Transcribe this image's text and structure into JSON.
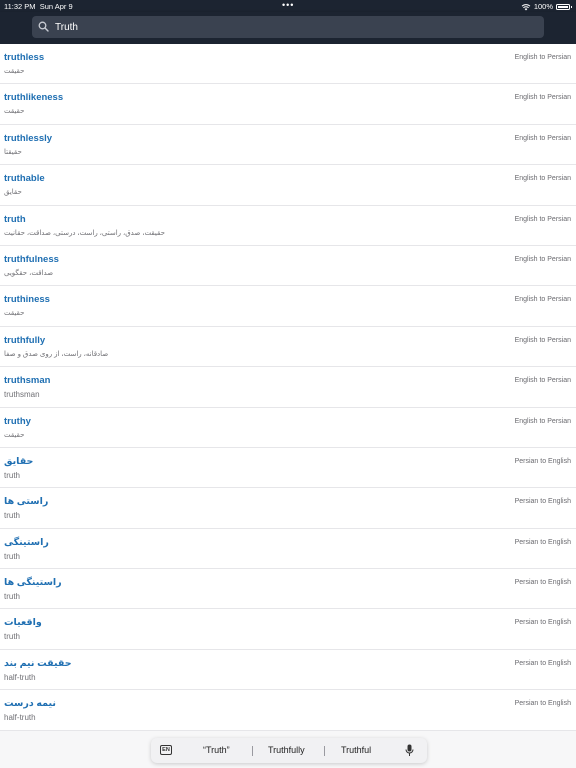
{
  "status_bar": {
    "time": "11:32 PM",
    "date": "Sun Apr 9",
    "dots": "•••",
    "battery_percent": "100%"
  },
  "search": {
    "value": "Truth"
  },
  "results": [
    {
      "word": "truthless",
      "meaning": "حقیقت",
      "direction": "English to Persian"
    },
    {
      "word": "truthlikeness",
      "meaning": "حقیقت",
      "direction": "English to Persian"
    },
    {
      "word": "truthlessly",
      "meaning": "حقیقتا",
      "direction": "English to Persian"
    },
    {
      "word": "truthable",
      "meaning": "حقایق",
      "direction": "English to Persian"
    },
    {
      "word": "truth",
      "meaning": "حقیقت، صدق، راستی، راست، درستی، صداقت، حقانیت",
      "direction": "English to Persian"
    },
    {
      "word": "truthfulness",
      "meaning": "صداقت، حقگویی",
      "direction": "English to Persian"
    },
    {
      "word": "truthiness",
      "meaning": "حقیقت",
      "direction": "English to Persian"
    },
    {
      "word": "truthfully",
      "meaning": "صادقانه، راست، از روی صدق و صفا",
      "direction": "English to Persian"
    },
    {
      "word": "truthsman",
      "meaning": "truthsman",
      "direction": "English to Persian"
    },
    {
      "word": "truthy",
      "meaning": "حقیقت",
      "direction": "English to Persian"
    },
    {
      "word": "حقایق",
      "meaning": "truth",
      "direction": "Persian to English"
    },
    {
      "word": "راستی ها",
      "meaning": "truth",
      "direction": "Persian to English"
    },
    {
      "word": "راستینگی",
      "meaning": "truth",
      "direction": "Persian to English"
    },
    {
      "word": "راستینگی ها",
      "meaning": "truth",
      "direction": "Persian to English"
    },
    {
      "word": "واقعیات",
      "meaning": "truth",
      "direction": "Persian to English"
    },
    {
      "word": "حقیقت نیم بند",
      "meaning": "half-truth",
      "direction": "Persian to English"
    },
    {
      "word": "نیمه درست",
      "meaning": "half-truth",
      "direction": "Persian to English"
    }
  ],
  "keyboard": {
    "lang": "EN",
    "suggestions": [
      "“Truth”",
      "Truthfully",
      "Truthful"
    ]
  },
  "colors": {
    "header_bg": "#1c2431",
    "search_bg": "#3a4250",
    "word_link": "#1f6fb2",
    "row_bg": "#ffffff"
  }
}
